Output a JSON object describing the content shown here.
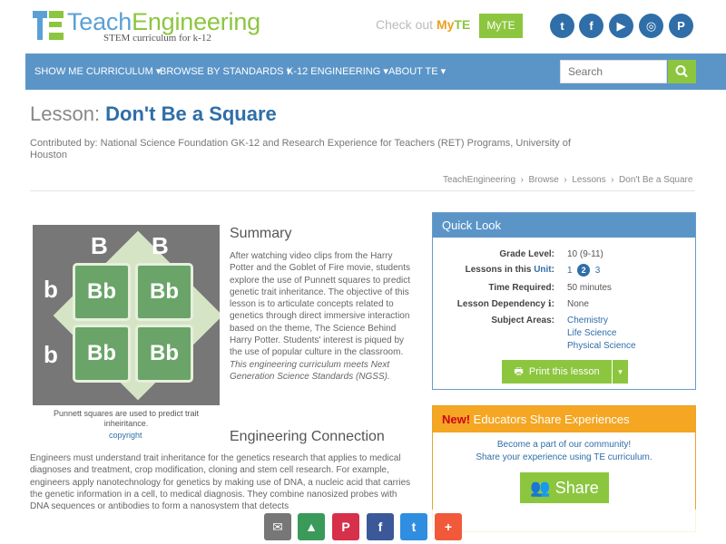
{
  "header": {
    "logo_title_1": "Teach",
    "logo_title_2": "Engineering",
    "logo_sub": "STEM curriculum for k-12",
    "checkout_text": "Check out",
    "checkout_my": "My",
    "checkout_te": "TE",
    "myte_label": "MyTE",
    "social": [
      {
        "name": "twitter",
        "glyph": "t",
        "color": "#2f6ea8"
      },
      {
        "name": "facebook",
        "glyph": "f",
        "color": "#2f6ea8"
      },
      {
        "name": "youtube",
        "glyph": "▶",
        "color": "#2f6ea8"
      },
      {
        "name": "instagram",
        "glyph": "◎",
        "color": "#2f6ea8"
      },
      {
        "name": "pinterest",
        "glyph": "P",
        "color": "#2f6ea8"
      }
    ]
  },
  "nav": {
    "items": [
      {
        "label": "SHOW ME CURRICULUM ▾"
      },
      {
        "label": "BROWSE BY STANDARDS ▾"
      },
      {
        "label": "K-12 ENGINEERING ▾"
      },
      {
        "label": "ABOUT TE ▾"
      }
    ],
    "search_placeholder": "Search"
  },
  "lesson": {
    "prefix": "Lesson: ",
    "title": "Don't Be a Square",
    "contributed": "Contributed by: National Science Foundation GK-12 and Research Experience for Teachers (RET) Programs, University of Houston"
  },
  "breadcrumbs": [
    "TeachEngineering",
    "Browse",
    "Lessons",
    "Don't Be a Square"
  ],
  "figure": {
    "top_alleles": [
      "B",
      "B"
    ],
    "side_alleles": [
      "b",
      "b"
    ],
    "cells": [
      "Bb",
      "Bb",
      "Bb",
      "Bb"
    ],
    "caption": "Punnett squares are used to predict trait inheiritance.",
    "copyright": "copyright"
  },
  "summary": {
    "heading": "Summary",
    "text": "After watching video clips from the Harry Potter and the Goblet of Fire movie, students explore the use of Punnett squares to predict genetic trait inheritance. The objective of this lesson is to articulate concepts related to genetics through direct immersive interaction based on the theme, The Science Behind Harry Potter. Students' interest is piqued by the use of popular culture in the classroom.",
    "ngss": "This engineering curriculum meets Next Generation Science Standards (NGSS)."
  },
  "engineering": {
    "heading": "Engineering Connection",
    "text": "Engineers must understand trait inheritance for the genetics research that applies to medical diagnoses and treatment, crop modification, cloning and stem cell research. For example, engineers apply nanotechnology for genetics by making use of DNA, a nucleic acid that carries the genetic information in a cell, to medical diagnosis. They combine nanosized probes with DNA sequences or antibodies to form a nanosystem that detects"
  },
  "quick_look": {
    "heading": "Quick Look",
    "grade_label": "Grade Level:",
    "grade_value": "10 (9-11)",
    "lessons_label": "Lessons in this",
    "lessons_unit": "Unit",
    "lessons_colon": ":",
    "lesson_nums": [
      "1",
      "2",
      "3"
    ],
    "time_label": "Time Required:",
    "time_value": "50 minutes",
    "dependency_label": "Lesson Dependency",
    "dependency_info": "ℹ",
    "dependency_colon": ":",
    "dependency_value": "None",
    "subjects_label": "Subject Areas:",
    "subjects": [
      "Chemistry",
      "Life Science",
      "Physical Science"
    ],
    "print_label": "Print this lesson",
    "print_icon": "🖶",
    "caret": "▾"
  },
  "educators": {
    "new": "New!",
    "heading": " Educators Share Experiences",
    "line1": "Become a part of our community!",
    "line2": "Share your experience using TE curriculum.",
    "share_label": "Share",
    "share_icon": "👥"
  },
  "sharebar": [
    {
      "name": "email",
      "glyph": "✉",
      "color": "#777777"
    },
    {
      "name": "google-classroom",
      "glyph": "▲",
      "color": "#3a9a5a"
    },
    {
      "name": "pinterest",
      "glyph": "P",
      "color": "#d6304a"
    },
    {
      "name": "facebook",
      "glyph": "f",
      "color": "#3b5998"
    },
    {
      "name": "twitter",
      "glyph": "t",
      "color": "#2f8ee0"
    },
    {
      "name": "more",
      "glyph": "+",
      "color": "#f05a3a"
    }
  ]
}
